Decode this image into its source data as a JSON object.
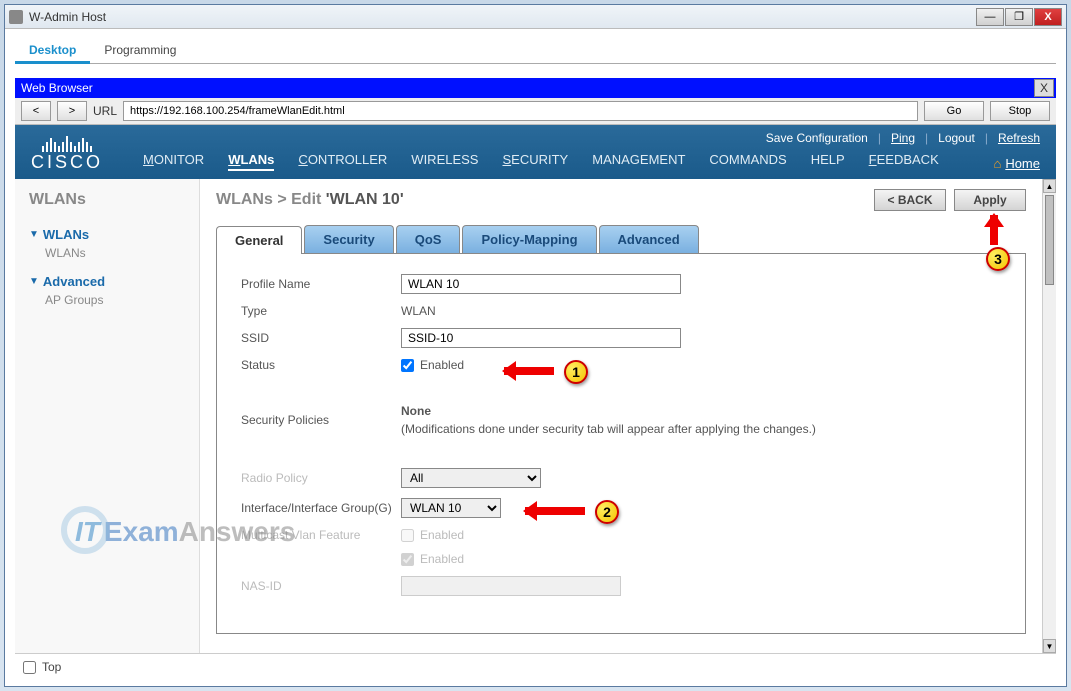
{
  "window": {
    "title": "W-Admin Host"
  },
  "app_tabs": {
    "t0": "Desktop",
    "t1": "Programming"
  },
  "browser": {
    "header": "Web Browser",
    "url_label": "URL",
    "url": "https://192.168.100.254/frameWlanEdit.html",
    "go": "Go",
    "stop": "Stop",
    "back": "<",
    "forward": ">"
  },
  "top_links": {
    "save": "Save Configuration",
    "ping": "Ping",
    "logout": "Logout",
    "refresh": "Refresh"
  },
  "logo_text": "CISCO",
  "nav": {
    "monitor": "ONITOR",
    "wlans": "LANs",
    "controller": "ONTROLLER",
    "wireless": "IRELESS",
    "security": "ECURITY",
    "management": "ANAGEMENT",
    "commands": "OMMANDS",
    "help": "ELP",
    "feedback": "EEDBACK",
    "home": "Home"
  },
  "sidebar": {
    "title": "WLANs",
    "sec1_head": "WLANs",
    "sec1_sub": "WLANs",
    "sec2_head": "Advanced",
    "sec2_sub": "AP Groups"
  },
  "page": {
    "crumb1": "WLANs > ",
    "crumb2": "Edit ",
    "crumb3": "'WLAN 10'",
    "back_btn": "< BACK",
    "apply_btn": "Apply"
  },
  "tabs": {
    "general": "General",
    "security": "Security",
    "qos": "QoS",
    "policy": "Policy-Mapping",
    "advanced": "Advanced"
  },
  "form": {
    "profile_label": "Profile Name",
    "profile_value": "WLAN 10",
    "type_label": "Type",
    "type_value": "WLAN",
    "ssid_label": "SSID",
    "ssid_value": "SSID-10",
    "status_label": "Status",
    "status_text": "Enabled",
    "secpol_label": "Security Policies",
    "secpol_value": "None",
    "secpol_note": "(Modifications done under security tab will appear after applying the changes.)",
    "radio_label": "Radio Policy",
    "radio_value": "All",
    "iface_label": "Interface/Interface Group(G)",
    "iface_value": "WLAN 10",
    "mcast_label": "Multicast Vlan Feature",
    "mcast_text": "Enabled",
    "broadcast_text": "Enabled",
    "nasid_label": "NAS-ID"
  },
  "callouts": {
    "c1": "1",
    "c2": "2",
    "c3": "3"
  },
  "watermark": {
    "it": "IT",
    "exam": "Exam",
    "answers": "Answers"
  },
  "footer": {
    "top": "Top"
  }
}
